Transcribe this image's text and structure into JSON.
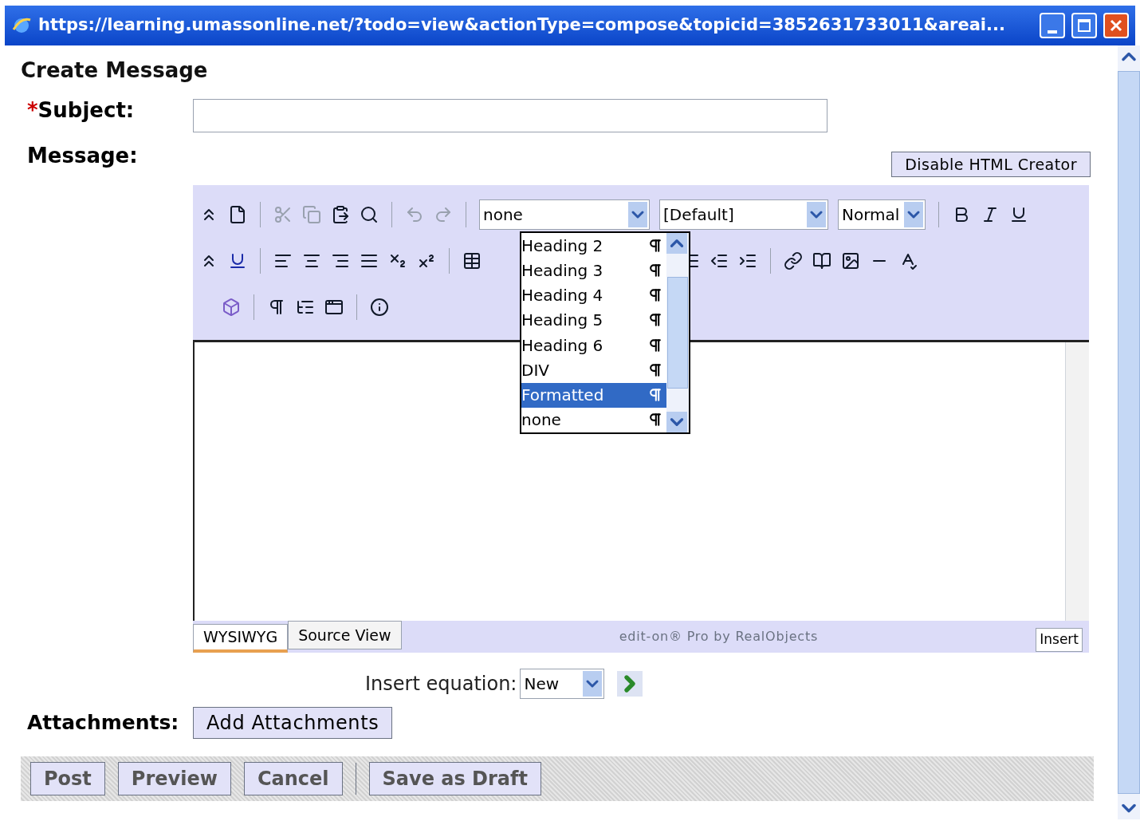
{
  "window": {
    "title": "https://learning.umassonline.net/?todo=view&actionType=compose&topicid=3852631733011&areai..."
  },
  "heading": "Create Message",
  "subject": {
    "required_mark": "*",
    "label": "Subject:"
  },
  "message": {
    "label": "Message:"
  },
  "disable_button": "Disable HTML Creator",
  "editor": {
    "paragraph_select": "none",
    "font_select": "[Default]",
    "size_select": "Normal",
    "dropdown": [
      {
        "label": "Heading 2",
        "selected": false
      },
      {
        "label": "Heading 3",
        "selected": false
      },
      {
        "label": "Heading 4",
        "selected": false
      },
      {
        "label": "Heading 5",
        "selected": false
      },
      {
        "label": "Heading 6",
        "selected": false
      },
      {
        "label": "DIV",
        "selected": false
      },
      {
        "label": "Formatted",
        "selected": true
      },
      {
        "label": "none",
        "selected": false
      }
    ],
    "tabs": [
      {
        "label": "WYSIWYG",
        "selected": true
      },
      {
        "label": "Source View",
        "selected": false
      }
    ],
    "credit": "edit-on® Pro by RealObjects",
    "insert_button": "Insert"
  },
  "equation": {
    "label": "Insert equation:",
    "value": "New"
  },
  "attachments": {
    "label": "Attachments:",
    "button": "Add Attachments"
  },
  "actions": [
    "Post",
    "Preview",
    "Cancel",
    "Save as Draft"
  ]
}
